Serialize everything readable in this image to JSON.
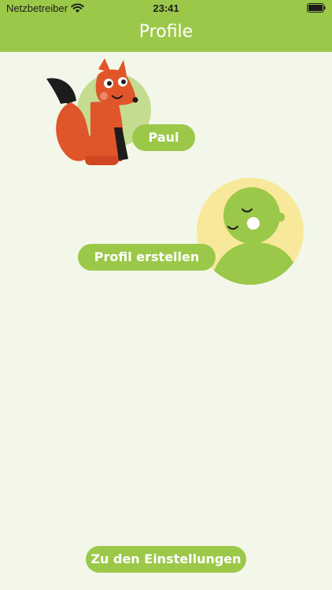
{
  "status_bar": {
    "carrier": "Netzbetreiber",
    "time": "23:41"
  },
  "header": {
    "title": "Profile"
  },
  "profiles": [
    {
      "name": "Paul",
      "avatar_icon": "fox-icon"
    }
  ],
  "create_profile": {
    "label": "Profil erstellen",
    "avatar_icon": "baby-silhouette-icon"
  },
  "footer": {
    "settings_label": "Zu den Einstellungen"
  },
  "colors": {
    "accent": "#9cc84a",
    "background": "#f3f7e9",
    "fox": "#e0552a",
    "baby_bg": "#f8e89a"
  }
}
